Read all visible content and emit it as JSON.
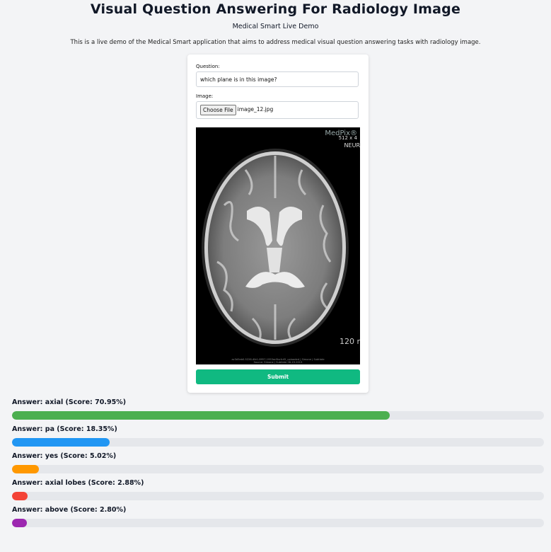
{
  "header": {
    "title": "Visual Question Answering For Radiology Image",
    "subtitle": "Medical Smart Live Demo",
    "description": "This is a live demo of the Medical Smart application that aims to address medical visual question answering tasks with radiology image."
  },
  "form": {
    "question_label": "Question:",
    "question_value": "which plane is in this image?",
    "image_label": "Image:",
    "file_button_label": "Choose File",
    "file_name": "image_12.jpg",
    "submit_label": "Submit"
  },
  "image_overlay": {
    "watermark": "MedPix®",
    "dims": "512   x 4",
    "section": "NEUR",
    "scale": "120 r",
    "footer_line1": "ac3d5eb0-5226-4fe1-8957-1953ac9bcfc45_uploaded | Simone | Subtlate",
    "footer_line2": "Source: Simone | Subtlate 06-19-2013"
  },
  "answers": [
    {
      "label": "Answer: axial (Score: 70.95%)",
      "score": 70.95,
      "color": "#4caf50"
    },
    {
      "label": "Answer: pa (Score: 18.35%)",
      "score": 18.35,
      "color": "#2196f3"
    },
    {
      "label": "Answer: yes (Score: 5.02%)",
      "score": 5.02,
      "color": "#ff9800"
    },
    {
      "label": "Answer: axial lobes (Score: 2.88%)",
      "score": 2.88,
      "color": "#f44336"
    },
    {
      "label": "Answer: above (Score: 2.80%)",
      "score": 2.8,
      "color": "#9c27b0"
    }
  ]
}
